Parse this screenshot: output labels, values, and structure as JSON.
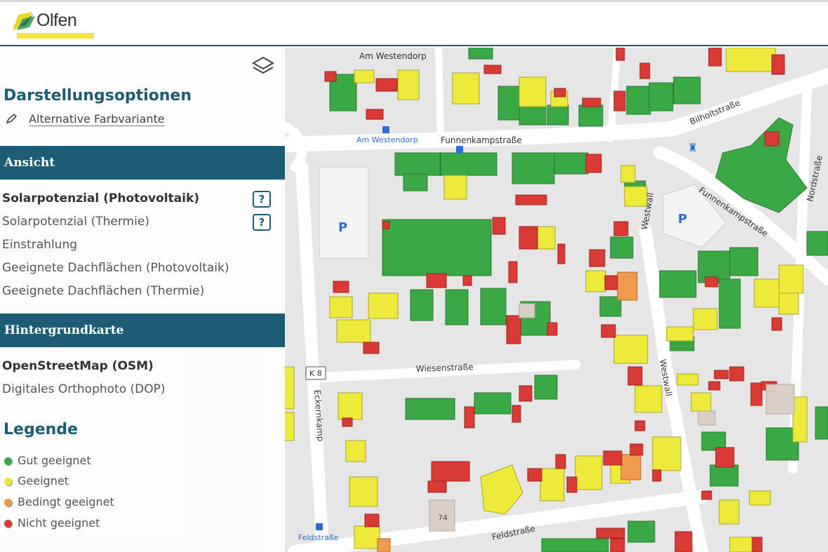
{
  "header": {
    "logo_text": "Olfen"
  },
  "colors": {
    "brand": "#1c5d75",
    "gut_geeignet": "#3aa845",
    "geeignet": "#eeea3b",
    "bedingt_geeignet": "#f09a4e",
    "nicht_geeignet": "#d93a33",
    "road": "#ffffff",
    "land": "#e6e6e6"
  },
  "panel": {
    "title": "Darstellungsoptionen",
    "alt_color_label": "Alternative Farbvariante",
    "layers_icon": "layers-icon",
    "view_section": {
      "title": "Ansicht",
      "options": [
        {
          "label": "Solarpotenzial (Photovoltaik)",
          "selected": true,
          "help": "?"
        },
        {
          "label": "Solarpotenzial (Thermie)",
          "selected": false,
          "help": "?"
        },
        {
          "label": "Einstrahlung",
          "selected": false
        },
        {
          "label": "Geeignete Dachflächen (Photovoltaik)",
          "selected": false
        },
        {
          "label": "Geeignete Dachflächen (Thermie)",
          "selected": false
        }
      ]
    },
    "basemap_section": {
      "title": "Hintergrundkarte",
      "options": [
        {
          "label": "OpenStreetMap (OSM)",
          "selected": true
        },
        {
          "label": "Digitales Orthophoto (DOP)",
          "selected": false
        }
      ]
    },
    "legend": {
      "title": "Legende",
      "items": [
        {
          "label": "Gut geeignet",
          "color": "#3aa845"
        },
        {
          "label": "Geeignet",
          "color": "#eeea3b"
        },
        {
          "label": "Bedingt geeignet",
          "color": "#f09a4e"
        },
        {
          "label": "Nicht geeignet",
          "color": "#d93a33"
        }
      ]
    }
  },
  "map": {
    "street_labels": [
      "Am Westendorp",
      "Funnenkampstraße",
      "Bilholtstraße",
      "Westwall",
      "Wiesenstraße",
      "Eckernkamp",
      "Feldstraße",
      "Nordstraße"
    ],
    "poi_labels": [
      "Am Westendorp",
      "Feldstraße"
    ],
    "road_shield": "K 8",
    "parking_symbol": "P",
    "house_number": "74"
  }
}
